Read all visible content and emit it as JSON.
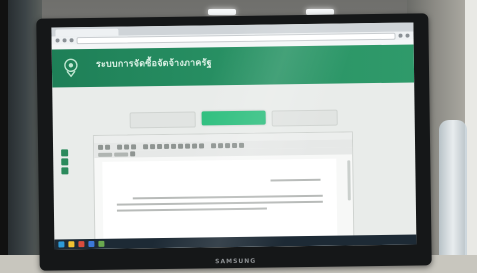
{
  "monitor": {
    "brand": "SAMSUNG"
  },
  "browser": {
    "tab_label": "",
    "url": "",
    "bookmarks": [
      "",
      "",
      "",
      ""
    ]
  },
  "site": {
    "title": "ระบบการจัดซื้อจัดจ้างภาครัฐ",
    "subtitle": "",
    "header_info": [
      "",
      "",
      ""
    ]
  },
  "breadcrumb": [
    "",
    "",
    ""
  ],
  "steps": [
    {
      "label": "",
      "state": "inactive"
    },
    {
      "label": "",
      "state": "active"
    },
    {
      "label": "",
      "state": "inactive"
    }
  ],
  "editor": {
    "title": "",
    "doc_heading": "",
    "doc_signature": ""
  },
  "taskbar": {
    "clock": ""
  },
  "colors": {
    "header_green": "#1e7f57",
    "active_step": "#2fbf7f",
    "taskbar": "#1d2a35"
  }
}
